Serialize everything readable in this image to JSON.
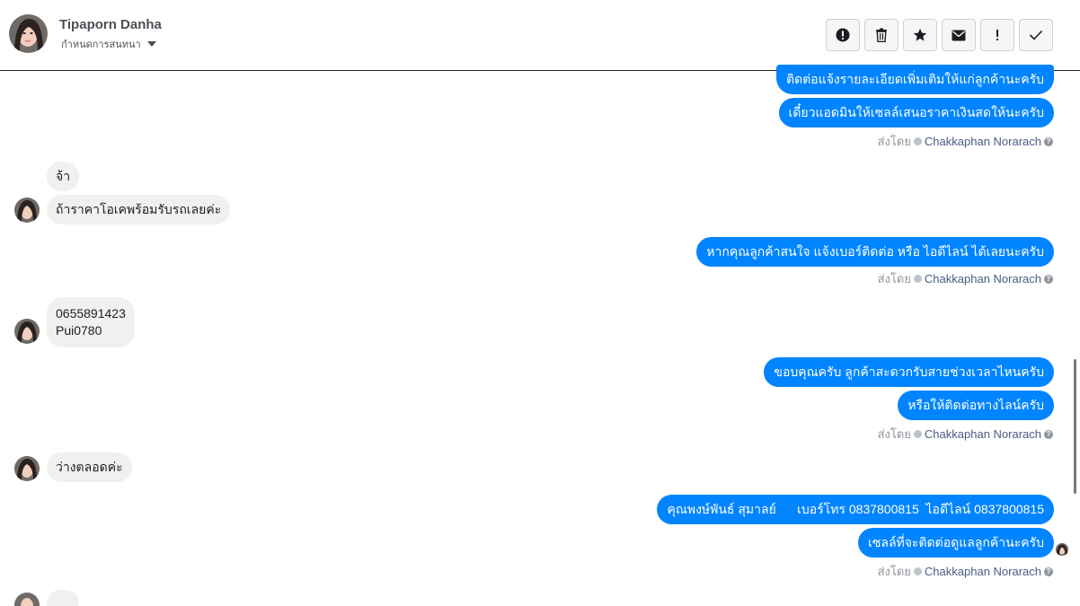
{
  "header": {
    "name": "Tipaporn Danha",
    "subtitle": "กำหนดการสนทนา"
  },
  "toolbar": {
    "buttons": [
      "alert-icon",
      "trash-icon",
      "star-icon",
      "envelope-icon",
      "exclamation-icon",
      "checkmark-icon"
    ]
  },
  "messages": {
    "m1": "ติดต่อแจ้งรายละเอียดเพิ่มเติมให้แก่ลูกค้านะครับ",
    "m2": "เดี๋ยวแอดมินให้เซลล์เสนอราคาเงินสดให้นะครับ",
    "m3": "จ้า",
    "m4": "ถ้าราคาโอเคพร้อมรับรถเลยค่ะ",
    "m5": "หากคุณลูกค้าสนใจ แจ้งเบอร์ติดต่อ หรือ ไอดีไลน์ ได้เลยนะครับ",
    "m6_line1": "0655891423",
    "m6_line2": "Pui0780",
    "m7": "ขอบคุณครับ ลูกค้าสะดวกรับสายช่วงเวลาไหนครับ",
    "m8": "หรือให้ติดต่อทางไลน์ครับ",
    "m9": "ว่างตลอดค่ะ",
    "m10": "คุณพงษ์พันธ์ สุมาลย์      เบอร์โทร 0837800815  ไอดีไลน์ 0837800815",
    "m11": "เซลล์ที่จะติดต่อดูแลลูกค้านะครับ"
  },
  "sent_by": {
    "label": "ส่งโดย",
    "author": "Chakkaphan Norarach"
  },
  "colors": {
    "outgoing_bubble": "#0084ff",
    "incoming_bubble": "#f1f0f0",
    "author_link": "#4b5b85"
  }
}
